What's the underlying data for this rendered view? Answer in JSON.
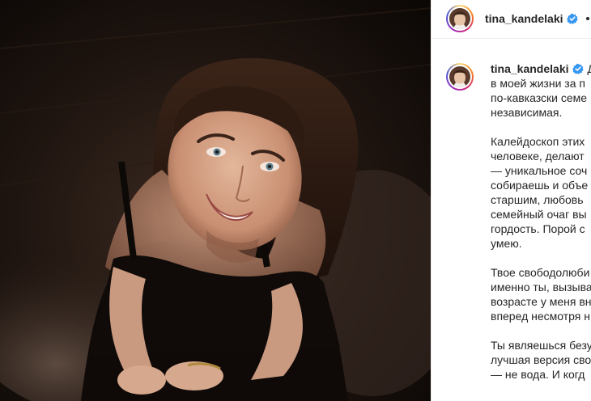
{
  "post": {
    "username": "tina_kandelaki",
    "verified": true,
    "more_icon": "more-options-icon"
  },
  "caption": {
    "username": "tina_kandelaki",
    "first_word": "Д",
    "paragraph1": [
      "в моей жизни за п",
      "по-кавказски семе",
      "независимая."
    ],
    "paragraph2": [
      "Калейдоскоп этих",
      "человеке, делают",
      "— уникальное соч",
      "собираешь и объе",
      "старшим, любовь",
      "семейный очаг вы",
      "гордость. Порой с",
      "умею."
    ],
    "paragraph3": [
      "Твое свободолюби",
      "именно ты, вызыва",
      "возрасте у меня вн",
      "вперед несмотря н"
    ],
    "paragraph4": [
      "Ты являешься безу",
      "лучшая версия сво",
      "— не вода. И когд"
    ]
  },
  "colors": {
    "verified_blue": "#3897f0",
    "text": "#262626"
  }
}
